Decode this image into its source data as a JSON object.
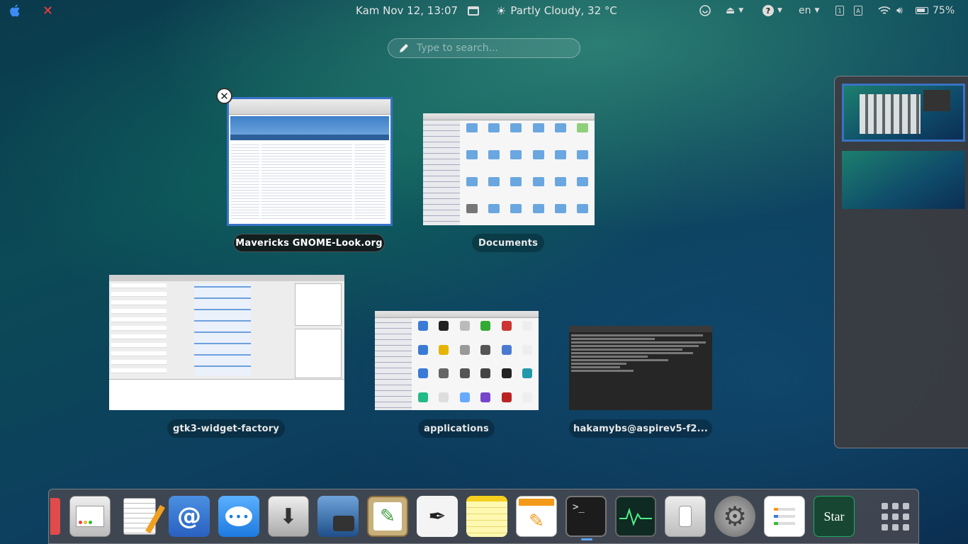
{
  "top_panel": {
    "close_symbol": "✕",
    "clock": "Kam Nov 12, 13:07",
    "weather": "Partly Cloudy, 32 °C",
    "language": "en",
    "battery": "75%",
    "input_indicator_1": "1",
    "input_indicator_2": "A"
  },
  "search": {
    "placeholder": "Type to search..."
  },
  "windows": [
    {
      "title": "Mavericks GNOME-Look.org",
      "active": true
    },
    {
      "title": "Documents",
      "active": false
    },
    {
      "title": "gtk3-widget-factory",
      "active": false
    },
    {
      "title": "applications",
      "active": false
    },
    {
      "title": "hakamybs@aspirev5-f2...",
      "active": false
    }
  ],
  "dock": {
    "items": [
      "system-monitor-app",
      "text-editor-app",
      "mail-app",
      "messages-app",
      "installer-app",
      "image-viewer-app",
      "drawing-app",
      "sketch-app",
      "notes-app",
      "writer-app",
      "terminal-app",
      "activity-monitor-app",
      "light-switch-app",
      "settings-app",
      "reminders-app",
      "stardict-app",
      "app-grid"
    ],
    "stardict_label": "Star"
  },
  "colors": {
    "accent": "#3873c5",
    "close_red": "#ff3b3b",
    "dock_indicator": "#5ea4ff"
  }
}
